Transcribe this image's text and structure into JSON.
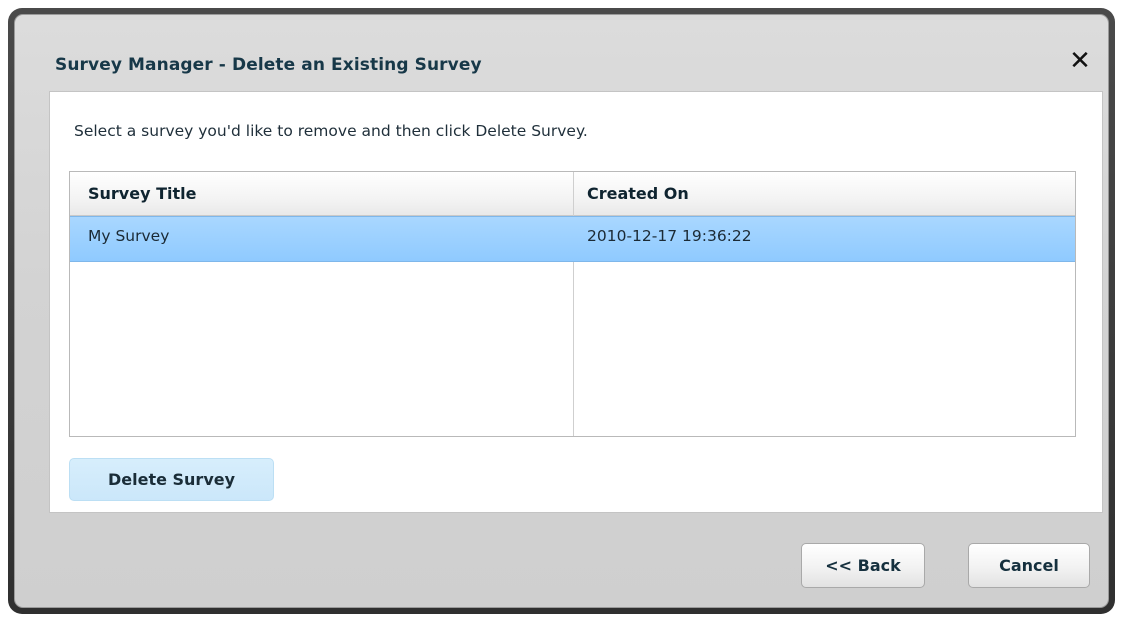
{
  "dialog": {
    "title": "Survey Manager - Delete an Existing Survey",
    "close_icon": "close-icon"
  },
  "instruction": "Select a survey you'd like to remove and then click Delete Survey.",
  "grid": {
    "columns": [
      "Survey Title",
      "Created On"
    ],
    "rows": [
      {
        "title": "My Survey",
        "created_on": "2010-12-17 19:36:22",
        "selected": true
      }
    ],
    "selected_color": "#99CEFF"
  },
  "buttons": {
    "delete": "Delete Survey",
    "back": "<< Back",
    "cancel": "Cancel"
  }
}
